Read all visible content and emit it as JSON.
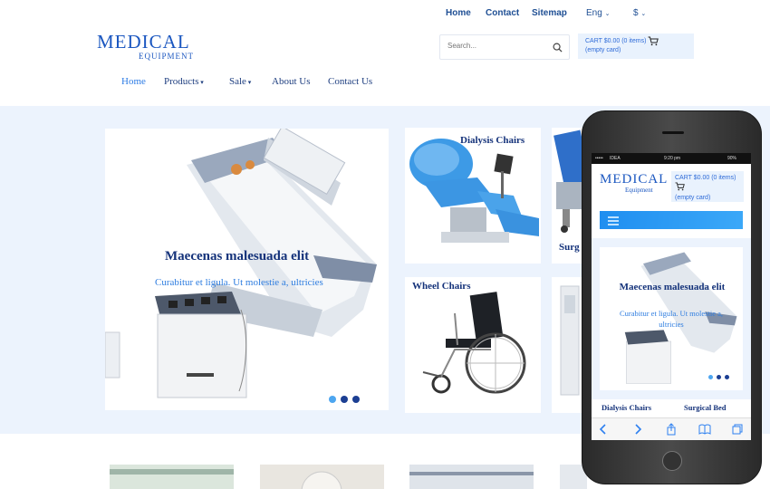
{
  "top_links": [
    "Home",
    "Contact",
    "Sitemap"
  ],
  "language": "Eng",
  "currency": "$",
  "logo": {
    "line1": "MEDICAL",
    "line2": "EQUIPMENT"
  },
  "search": {
    "placeholder": "Search..."
  },
  "cart": {
    "summary": "CART $0.00 (0 items)",
    "status": "(empty card)"
  },
  "nav": {
    "home": "Home",
    "products": "Products",
    "sale": "Sale",
    "about": "About Us",
    "contact": "Contact Us"
  },
  "slider": {
    "title": "Maecenas malesuada elit",
    "subtitle": "Curabitur et ligula. Ut molestie a, ultricies",
    "slide_count": 3,
    "active_slide": 1
  },
  "panels": {
    "dialysis": "Dialysis Chairs",
    "wheel": "Wheel Chairs",
    "surgical": "Surg"
  },
  "phone": {
    "status": {
      "carrier": "IDEA",
      "time": "9:20 pm",
      "battery": "90%"
    },
    "logo": {
      "line1": "MEDICAL",
      "line2": "Equipment"
    },
    "cart": {
      "summary": "CART $0.00 (0 items)",
      "status": "(empty card)"
    },
    "slider": {
      "title": "Maecenas malesuada elit",
      "subtitle": "Curabitur et ligula. Ut molestie a, ultricies"
    },
    "bottom": {
      "left": "Dialysis Chairs",
      "right": "Surgical Bed"
    }
  },
  "colors": {
    "accent": "#2c7be5",
    "navy": "#14327a",
    "band": "#ecf3fd"
  }
}
